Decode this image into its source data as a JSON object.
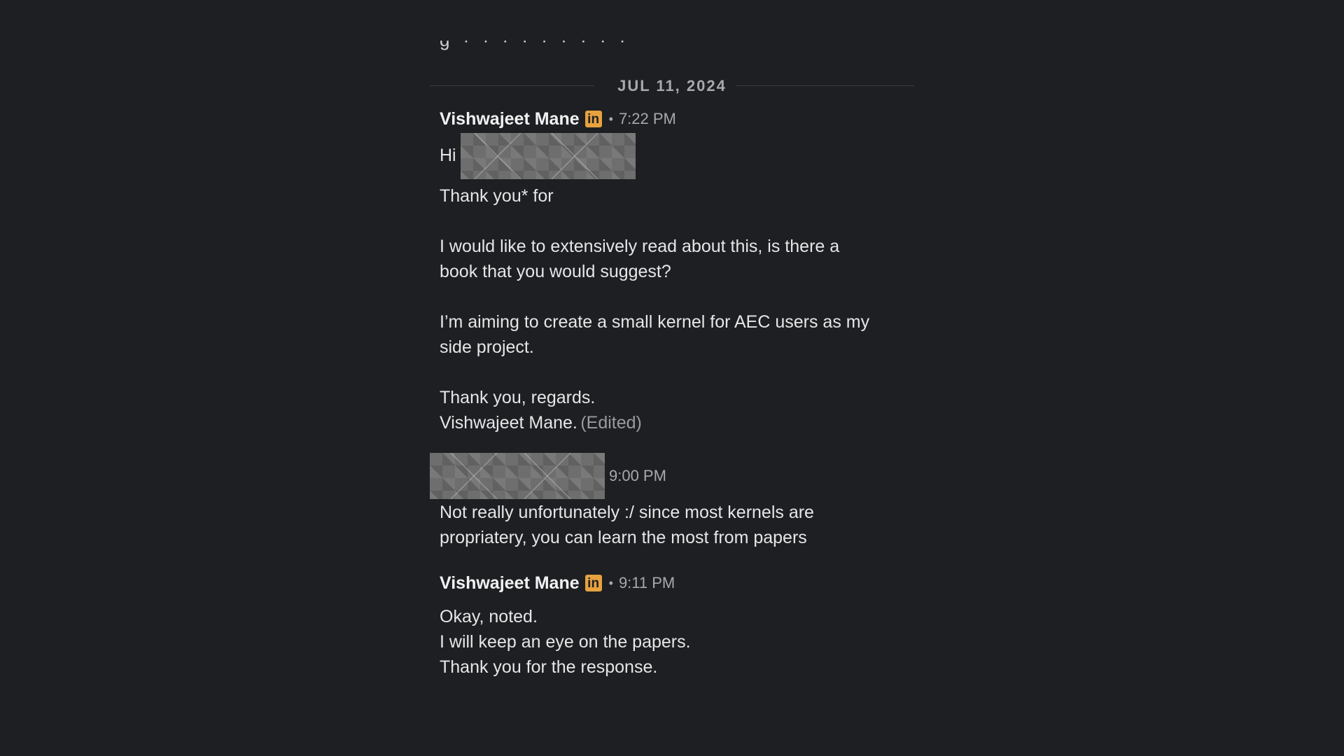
{
  "conversation": {
    "date_divider": "JUL 11, 2024",
    "messages": [
      {
        "sender": "Vishwajeet Mane",
        "badge": "in",
        "separator": "•",
        "time": "7:22 PM",
        "greeting": "Hi",
        "paragraphs": [
          "Thank you* for",
          "I would like to extensively read about this, is there a\nbook that you would suggest?",
          "I’m aiming to create a small kernel for AEC users as my\nside project.",
          "Thank you, regards.\nVishwajeet Mane."
        ],
        "edited_label": "(Edited)"
      },
      {
        "time": "9:00 PM",
        "text": "Not really unfortunately :/ since most kernels are\npropriatery, you can learn the most from papers"
      },
      {
        "sender": "Vishwajeet Mane",
        "badge": "in",
        "separator": "•",
        "time": "9:11 PM",
        "text": "Okay, noted.\nI will keep an eye on the papers.\nThank you for the response."
      }
    ]
  },
  "colors": {
    "background": "#1d1f23",
    "text_primary": "#e6e6e6",
    "text_muted": "#a8a9ab",
    "badge_bg": "#e7a23f"
  }
}
